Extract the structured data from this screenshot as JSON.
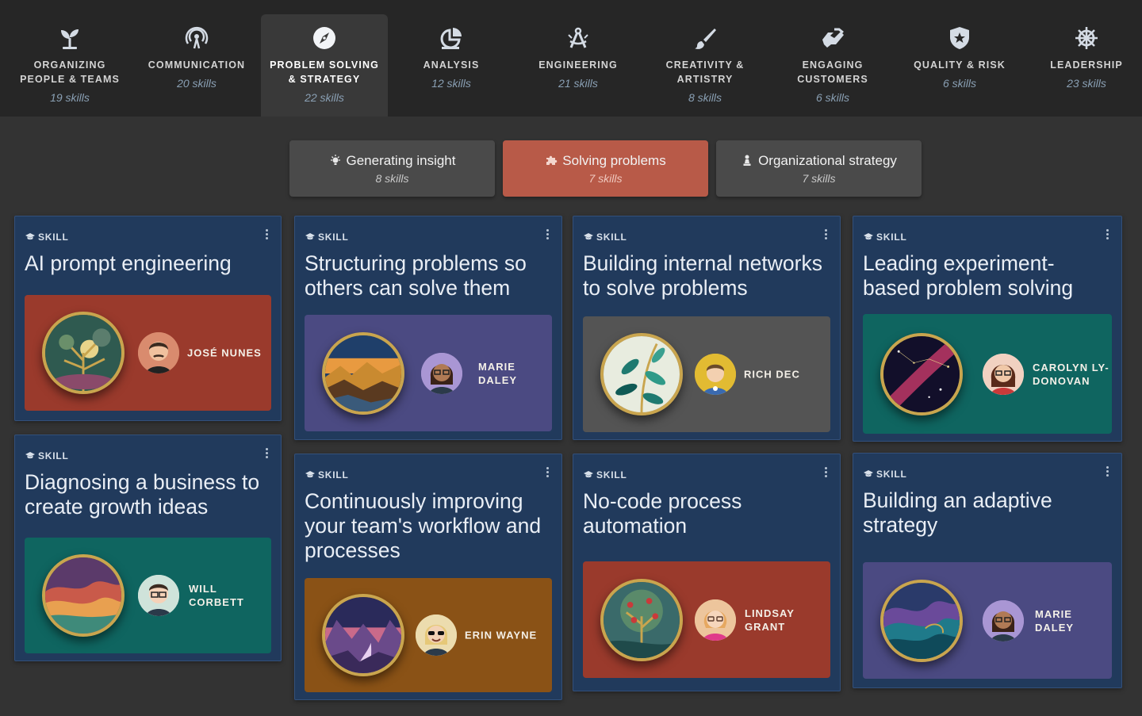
{
  "categories": [
    {
      "name": "ORGANIZING PEOPLE & TEAMS",
      "line1": "ORGANIZING",
      "line2": "PEOPLE & TEAMS",
      "count": "19 skills",
      "icon": "sprout-icon"
    },
    {
      "name": "COMMUNICATION",
      "line1": "COMMUNICATION",
      "line2": "",
      "count": "20 skills",
      "icon": "broadcast-icon"
    },
    {
      "name": "PROBLEM SOLVING & STRATEGY",
      "line1": "PROBLEM SOLVING",
      "line2": "& STRATEGY",
      "count": "22 skills",
      "icon": "compass-icon"
    },
    {
      "name": "ANALYSIS",
      "line1": "ANALYSIS",
      "line2": "",
      "count": "12 skills",
      "icon": "chart-pie-icon"
    },
    {
      "name": "ENGINEERING",
      "line1": "ENGINEERING",
      "line2": "",
      "count": "21 skills",
      "icon": "drafting-compass-icon"
    },
    {
      "name": "CREATIVITY & ARTISTRY",
      "line1": "CREATIVITY &",
      "line2": "ARTISTRY",
      "count": "8 skills",
      "icon": "paintbrush-icon"
    },
    {
      "name": "ENGAGING CUSTOMERS",
      "line1": "ENGAGING",
      "line2": "CUSTOMERS",
      "count": "6 skills",
      "icon": "handshake-icon"
    },
    {
      "name": "QUALITY & RISK",
      "line1": "QUALITY & RISK",
      "line2": "",
      "count": "6 skills",
      "icon": "shield-star-icon"
    },
    {
      "name": "LEADERSHIP",
      "line1": "LEADERSHIP",
      "line2": "",
      "count": "23 skills",
      "icon": "ship-wheel-icon"
    }
  ],
  "active_category": "PROBLEM SOLVING & STRATEGY",
  "subtabs": [
    {
      "label": "Generating insight",
      "count": "8 skills",
      "icon": "lightbulb-icon"
    },
    {
      "label": "Solving problems",
      "count": "7 skills",
      "icon": "puzzle-icon"
    },
    {
      "label": "Organizational strategy",
      "count": "7 skills",
      "icon": "chess-pawn-icon"
    }
  ],
  "active_subtab": "Solving problems",
  "skill_tag": "SKILL",
  "cards": [
    {
      "title": "AI prompt engineering",
      "person": "JOSÉ NUNES",
      "badge_theme": "golden tree",
      "panel_color": "#9a3a2c"
    },
    {
      "title": "Diagnosing a business to create growth ideas",
      "person": "WILL CORBETT",
      "badge_theme": "canyon",
      "panel_color": "#0f6560"
    },
    {
      "title": "Structuring problems so others can solve them",
      "person": "MARIE DALEY",
      "badge_theme": "mountain sunset",
      "panel_color": "#4b4a82"
    },
    {
      "title": "Continuously improving your team's workflow and processes",
      "person": "ERIN WAYNE",
      "badge_theme": "night valley",
      "panel_color": "#8a5216"
    },
    {
      "title": "Building internal networks to solve problems",
      "person": "RICH DEC",
      "badge_theme": "teal leaves",
      "panel_color": "#545454"
    },
    {
      "title": "No-code process automation",
      "person": "LINDSAY GRANT",
      "badge_theme": "fruit tree",
      "panel_color": "#9a3a2c"
    },
    {
      "title": "Leading experiment-based problem solving",
      "person": "CAROLYN LY-DONOVAN",
      "badge_theme": "galaxy",
      "panel_color": "#0f6560"
    },
    {
      "title": "Building an adaptive strategy",
      "person": "MARIE DALEY",
      "badge_theme": "waves",
      "panel_color": "#4b4a82"
    }
  ]
}
